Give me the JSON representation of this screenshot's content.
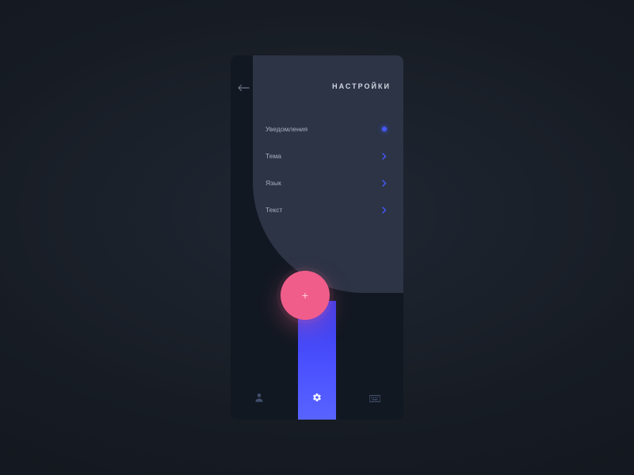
{
  "colors": {
    "accent": "#4659ff",
    "fab": "#f05d8a",
    "panel": "#2c3445"
  },
  "header": {
    "back_icon": "arrow-left",
    "title": "НАСТРОЙКИ"
  },
  "settings": [
    {
      "label": "Уведомления",
      "affordance": "dot"
    },
    {
      "label": "Тема",
      "affordance": "chevron"
    },
    {
      "label": "Язык",
      "affordance": "chevron"
    },
    {
      "label": "Текст",
      "affordance": "chevron"
    }
  ],
  "fab": {
    "glyph": "+",
    "icon": "plus-icon"
  },
  "nav": {
    "items": [
      {
        "icon": "person-icon",
        "active": false
      },
      {
        "icon": "gear-icon",
        "active": true
      },
      {
        "icon": "keyboard-icon",
        "active": false
      }
    ]
  }
}
